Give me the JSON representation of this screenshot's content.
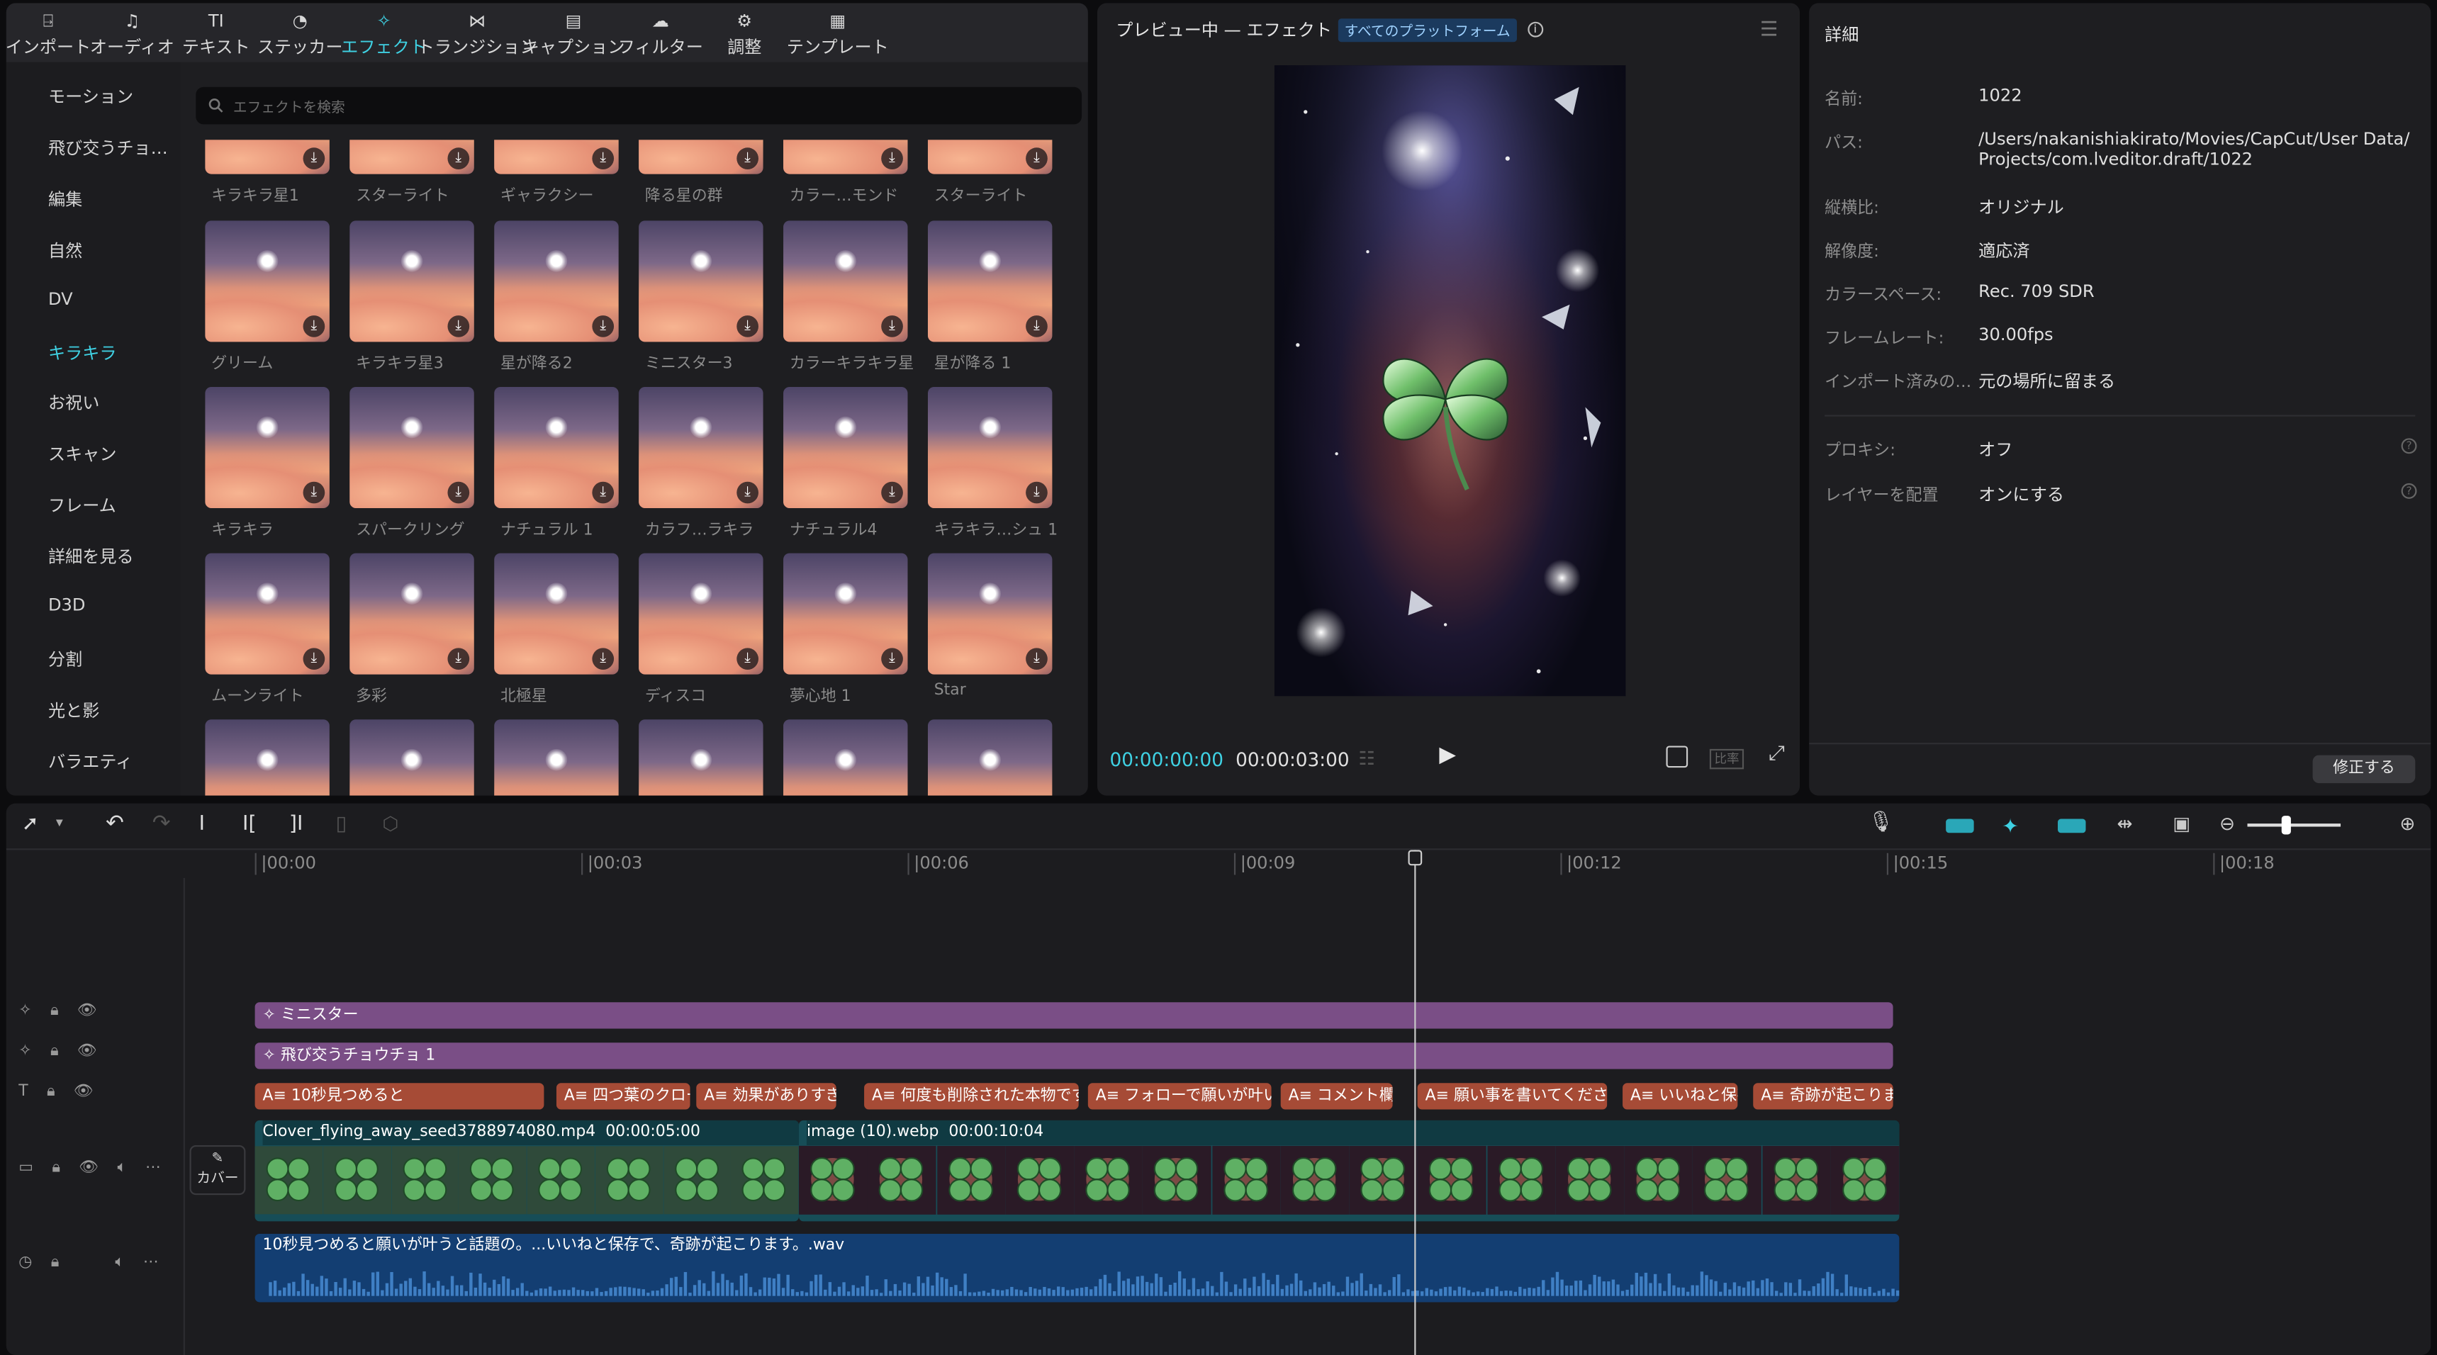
{
  "toolbar": {
    "items": [
      {
        "label": "インポート",
        "icon": "import-icon"
      },
      {
        "label": "オーディオ",
        "icon": "audio-icon"
      },
      {
        "label": "テキスト",
        "icon": "text-icon"
      },
      {
        "label": "ステッカー",
        "icon": "sticker-icon"
      },
      {
        "label": "エフェクト",
        "icon": "effects-icon",
        "active": true
      },
      {
        "label": "トランジション",
        "icon": "transition-icon"
      },
      {
        "label": "キャプション",
        "icon": "caption-icon"
      },
      {
        "label": "フィルター",
        "icon": "filter-icon"
      },
      {
        "label": "調整",
        "icon": "adjust-icon"
      },
      {
        "label": "テンプレート",
        "icon": "template-icon"
      }
    ]
  },
  "categories": [
    "モーション",
    "飛び交うチョ…",
    "編集",
    "自然",
    "DV",
    "キラキラ",
    "お祝い",
    "スキャン",
    "フレーム",
    "詳細を見る",
    "D3D",
    "分割",
    "光と影",
    "バラエティ"
  ],
  "active_category": "キラキラ",
  "search": {
    "placeholder": "エフェクトを検索"
  },
  "effects": [
    [
      "キラキラ星1",
      "スターライト",
      "ギャラクシー",
      "降る星の群",
      "カラー…モンド",
      "スターライト"
    ],
    [
      "グリーム",
      "キラキラ星3",
      "星が降る2",
      "ミニスター3",
      "カラーキラキラ星",
      "星が降る 1"
    ],
    [
      "キラキラ",
      "スパークリング",
      "ナチュラル 1",
      "カラフ…ラキラ",
      "ナチュラル4",
      "キラキラ…シュ 1"
    ],
    [
      "ムーンライト",
      "多彩",
      "北極星",
      "ディスコ",
      "夢心地 1",
      "Star"
    ],
    [
      "",
      "",
      "",
      "",
      "",
      ""
    ]
  ],
  "preview": {
    "title": "プレビュー中 — エフェクト",
    "platform_badge": "すべてのプラットフォーム",
    "current_time": "00:00:00:00",
    "total_time": "00:00:03:00",
    "ratio_label": "比率"
  },
  "detail": {
    "title": "詳細",
    "rows": [
      {
        "label": "名前:",
        "value": "1022"
      },
      {
        "label": "パス:",
        "value": "/Users/nakanishiakirato/Movies/CapCut/User Data/\nProjects/com.lveditor.draft/1022"
      },
      {
        "label": "縦横比:",
        "value": "オリジナル"
      },
      {
        "label": "解像度:",
        "value": "適応済"
      },
      {
        "label": "カラースペース:",
        "value": "Rec. 709 SDR"
      },
      {
        "label": "フレームレート:",
        "value": "30.00fps"
      },
      {
        "label": "インポート済みの…",
        "value": "元の場所に留まる"
      },
      {
        "label": "プロキシ:",
        "value": "オフ"
      },
      {
        "label": "レイヤーを配置",
        "value": "オンにする"
      }
    ],
    "fix_button": "修正する"
  },
  "timeline": {
    "ruler": [
      "|00:00",
      "|00:03",
      "|00:06",
      "|00:09",
      "|00:12",
      "|00:15",
      "|00:18"
    ],
    "effect_tracks": [
      "ミニスター",
      "飛び交うチョウチョ 1"
    ],
    "text_clips": [
      "10秒見つめると",
      "四つ葉のクロー",
      "効果がありすぎ",
      "何度も削除された本物です",
      "フォローで願いが叶い",
      "コメント欄に",
      "願い事を書いてください",
      "いいねと保存",
      "奇跡が起こります"
    ],
    "video_clips": [
      {
        "name": "Clover_flying_away_seed3788974080.mp4",
        "duration": "00:00:05:00"
      },
      {
        "name": "image (10).webp",
        "duration": "00:00:10:04"
      }
    ],
    "cover_label": "カバー",
    "audio_clip": "10秒見つめると願いが叶うと話題の。...いいねと保存で、奇跡が起こります。.wav"
  }
}
